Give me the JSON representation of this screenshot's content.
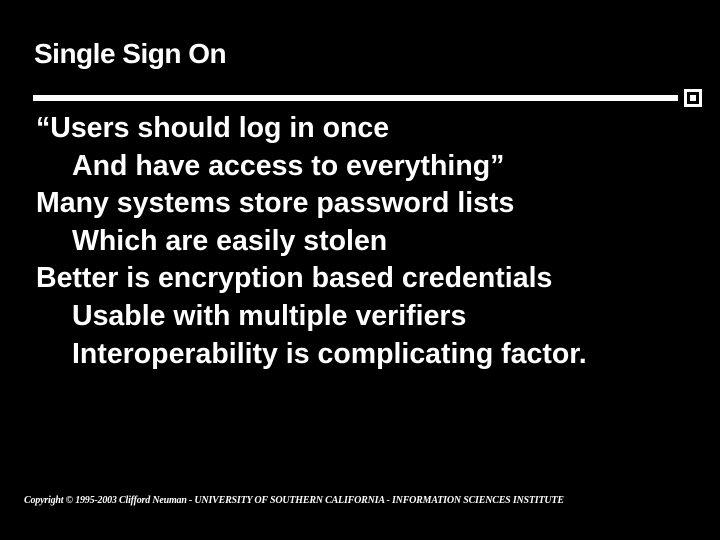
{
  "title": "Single Sign On",
  "body": {
    "lines": [
      {
        "level": 1,
        "text": "“Users should log in once"
      },
      {
        "level": 2,
        "text": "And have access to everything”"
      },
      {
        "level": 1,
        "text": "Many systems store password lists"
      },
      {
        "level": 2,
        "text": "Which are easily stolen"
      },
      {
        "level": 1,
        "text": "Better is encryption based credentials"
      },
      {
        "level": 2,
        "text": "Usable with multiple verifiers"
      },
      {
        "level": 2,
        "text": "Interoperability is complicating factor."
      }
    ]
  },
  "footer": "Copyright © 1995-2003 Clifford Neuman - UNIVERSITY OF SOUTHERN CALIFORNIA - INFORMATION SCIENCES INSTITUTE"
}
